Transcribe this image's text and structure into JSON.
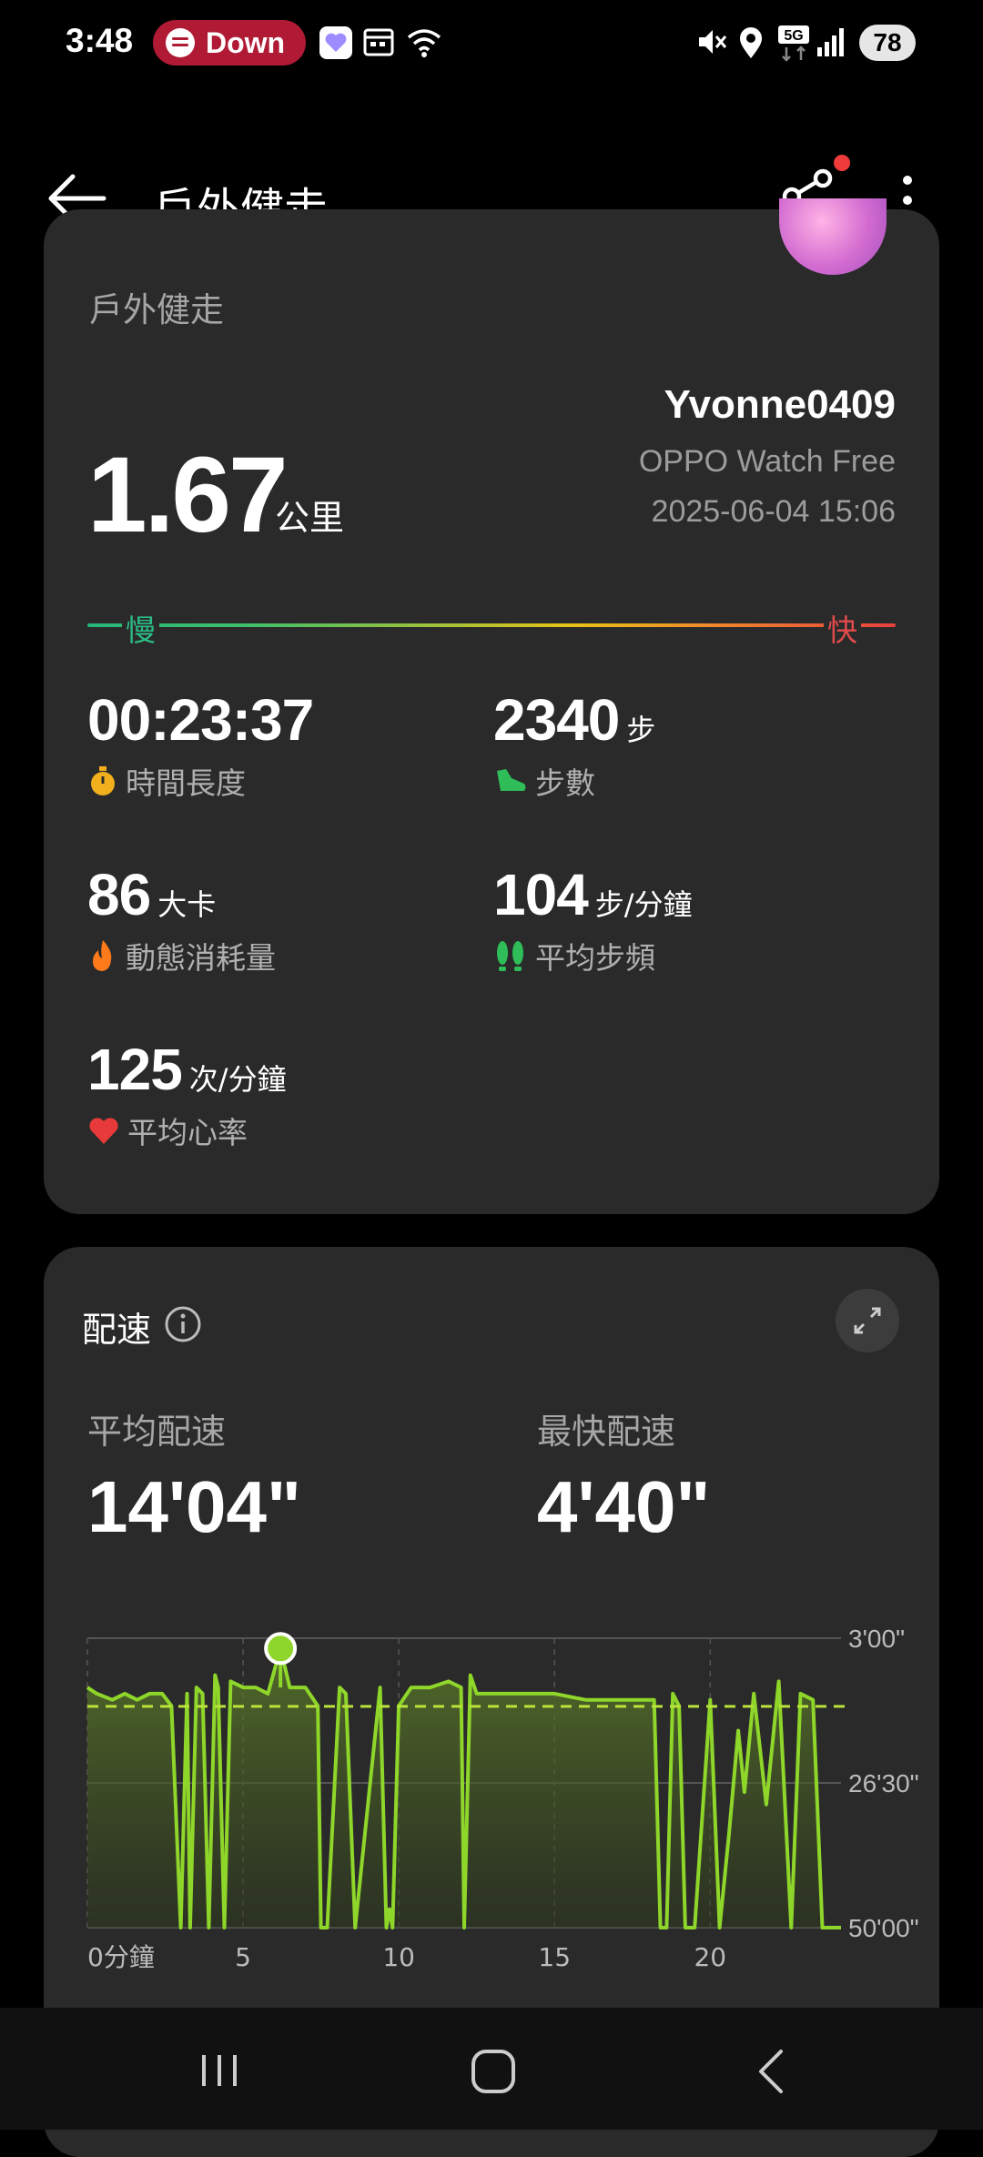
{
  "status_bar": {
    "time": "3:48",
    "notification": "Down",
    "battery": "78",
    "network": "5G"
  },
  "app_bar": {
    "title": "戶外健走"
  },
  "summary": {
    "sport_name": "戶外健走",
    "distance": "1.67",
    "distance_unit": "公里",
    "username": "Yvonne0409",
    "device": "OPPO Watch Free",
    "datetime": "2025-06-04 15:06",
    "speed_slow": "慢",
    "speed_fast": "快",
    "stats": [
      {
        "value": "00:23:37",
        "unit": "",
        "label": "時間長度",
        "icon": "stopwatch-icon",
        "color": "#f2b01e"
      },
      {
        "value": "2340",
        "unit": "步",
        "label": "步數",
        "icon": "shoe-icon",
        "color": "#2ebd59"
      },
      {
        "value": "86",
        "unit": "大卡",
        "label": "動態消耗量",
        "icon": "flame-icon",
        "color": "#ff7a1a"
      },
      {
        "value": "104",
        "unit": "步/分鐘",
        "label": "平均步頻",
        "icon": "footprints-icon",
        "color": "#2ebd59"
      },
      {
        "value": "125",
        "unit": "次/分鐘",
        "label": "平均心率",
        "icon": "heart-icon",
        "color": "#e83a3a"
      }
    ]
  },
  "pace": {
    "title": "配速",
    "avg_label": "平均配速",
    "avg_value": "14'04\"",
    "fast_label": "最快配速",
    "fast_value": "4'40\""
  },
  "chart_data": {
    "type": "area",
    "xlabel": "",
    "ylabel": "",
    "x_ticks": [
      "0分鐘",
      "5",
      "10",
      "15",
      "20"
    ],
    "y_ticks": [
      "3'00\"",
      "26'30\"",
      "50'00\""
    ],
    "ylim_minutes": [
      3,
      50
    ],
    "y_inverted": true,
    "avg_line_minutes": 14.07,
    "highlight_point": {
      "x": 6.2,
      "y": 4.67
    },
    "line_color": "#8fd62a",
    "x": [
      0,
      0.3,
      0.8,
      1.2,
      1.6,
      2.0,
      2.4,
      2.7,
      3.0,
      3.2,
      3.3,
      3.5,
      3.7,
      3.9,
      4.1,
      4.2,
      4.4,
      4.6,
      5.0,
      5.4,
      5.8,
      6.2,
      6.5,
      7.0,
      7.4,
      7.5,
      7.7,
      8.1,
      8.3,
      8.6,
      9.4,
      9.6,
      9.7,
      9.8,
      10.0,
      10.4,
      11.0,
      11.6,
      12.0,
      12.1,
      12.3,
      12.5,
      13.0,
      14.0,
      15.0,
      16.0,
      17.0,
      18.2,
      18.4,
      18.6,
      18.8,
      19.0,
      19.2,
      19.5,
      20.0,
      20.3,
      20.6,
      20.9,
      21.1,
      21.4,
      21.8,
      22.2,
      22.6,
      22.9,
      23.3,
      23.6,
      24.2
    ],
    "y": [
      11,
      12,
      13,
      12,
      13,
      12,
      12,
      14,
      50,
      12,
      50,
      11,
      12,
      50,
      9,
      11,
      50,
      10,
      11,
      11,
      12,
      4.67,
      11,
      11,
      14,
      50,
      50,
      11,
      12,
      50,
      11,
      50,
      47,
      50,
      14,
      11,
      11,
      10,
      11,
      50,
      9,
      12,
      12,
      12,
      12,
      13,
      13,
      13,
      50,
      50,
      12,
      14,
      50,
      50,
      13,
      50,
      35,
      18,
      28,
      12,
      30,
      10,
      50,
      12,
      13,
      50,
      50
    ]
  }
}
